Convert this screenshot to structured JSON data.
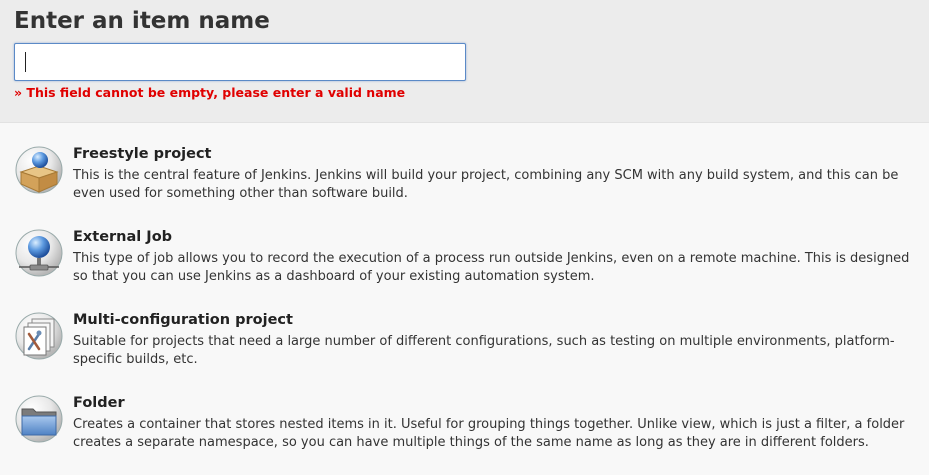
{
  "form": {
    "title": "Enter an item name",
    "name_value": "",
    "error": "» This field cannot be empty, please enter a valid name"
  },
  "items": [
    {
      "icon": "freestyle-project-icon",
      "title": "Freestyle project",
      "description": "This is the central feature of Jenkins. Jenkins will build your project, combining any SCM with any build system, and this can be even used for something other than software build."
    },
    {
      "icon": "external-job-icon",
      "title": "External Job",
      "description": "This type of job allows you to record the execution of a process run outside Jenkins, even on a remote machine. This is designed so that you can use Jenkins as a dashboard of your existing automation system."
    },
    {
      "icon": "multi-configuration-project-icon",
      "title": "Multi-configuration project",
      "description": "Suitable for projects that need a large number of different configurations, such as testing on multiple environments, platform-specific builds, etc."
    },
    {
      "icon": "folder-icon",
      "title": "Folder",
      "description": "Creates a container that stores nested items in it. Useful for grouping things together. Unlike view, which is just a filter, a folder creates a separate namespace, so you can have multiple things of the same name as long as they are in different folders."
    }
  ]
}
